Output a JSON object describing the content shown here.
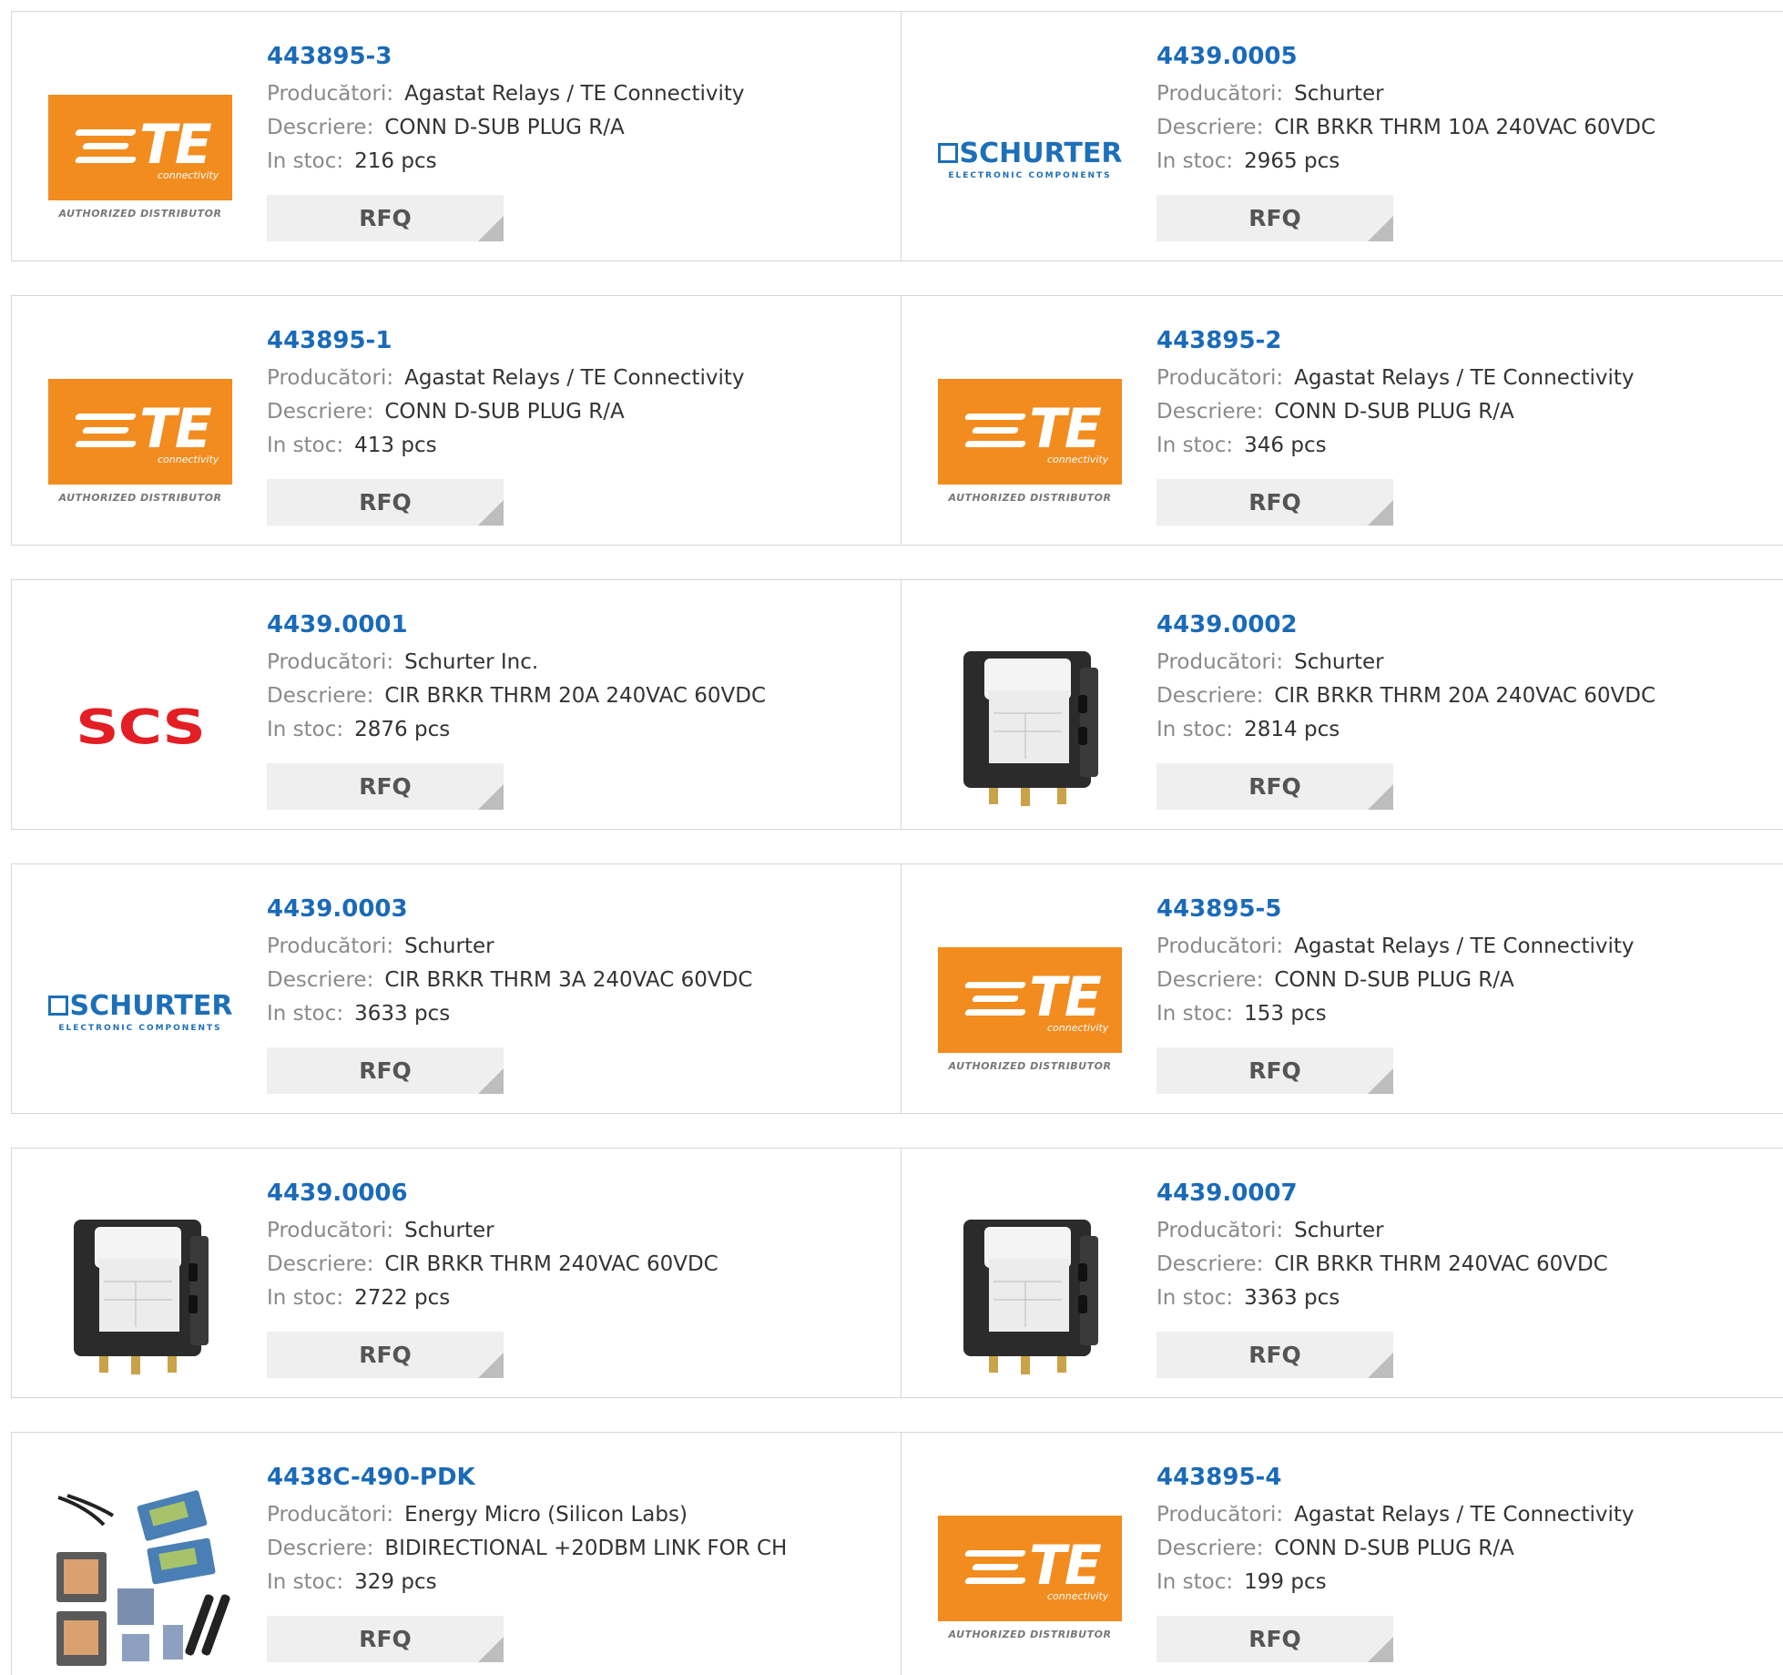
{
  "labels": {
    "manufacturer": "Producători:",
    "description": "Descriere:",
    "stock": "In stoc:",
    "rfq": "RFQ"
  },
  "logo_text": {
    "te": "TE",
    "te_sub": "connectivity",
    "te_authorized": "AUTHORIZED DISTRIBUTOR",
    "schurter": "SCHURTER",
    "schurter_sub": "ELECTRONIC COMPONENTS",
    "scs": "SCS"
  },
  "products": [
    {
      "part": "443895-3",
      "manufacturer": "Agastat Relays / TE Connectivity",
      "description": "CONN D-SUB PLUG R/A",
      "stock": "216 pcs",
      "image": "te-logo"
    },
    {
      "part": "4439.0005",
      "manufacturer": "Schurter",
      "description": "CIR BRKR THRM 10A 240VAC 60VDC",
      "stock": "2965 pcs",
      "image": "schurter-logo"
    },
    {
      "part": "443895-1",
      "manufacturer": "Agastat Relays / TE Connectivity",
      "description": "CONN D-SUB PLUG R/A",
      "stock": "413 pcs",
      "image": "te-logo"
    },
    {
      "part": "443895-2",
      "manufacturer": "Agastat Relays / TE Connectivity",
      "description": "CONN D-SUB PLUG R/A",
      "stock": "346 pcs",
      "image": "te-logo"
    },
    {
      "part": "4439.0001",
      "manufacturer": "Schurter Inc.",
      "description": "CIR BRKR THRM 20A 240VAC 60VDC",
      "stock": "2876 pcs",
      "image": "scs-logo"
    },
    {
      "part": "4439.0002",
      "manufacturer": "Schurter",
      "description": "CIR BRKR THRM 20A 240VAC 60VDC",
      "stock": "2814 pcs",
      "image": "breaker-photo"
    },
    {
      "part": "4439.0003",
      "manufacturer": "Schurter",
      "description": "CIR BRKR THRM 3A 240VAC 60VDC",
      "stock": "3633 pcs",
      "image": "schurter-logo"
    },
    {
      "part": "443895-5",
      "manufacturer": "Agastat Relays / TE Connectivity",
      "description": "CONN D-SUB PLUG R/A",
      "stock": "153 pcs",
      "image": "te-logo"
    },
    {
      "part": "4439.0006",
      "manufacturer": "Schurter",
      "description": "CIR BRKR THRM 240VAC 60VDC",
      "stock": "2722 pcs",
      "image": "breaker-photo"
    },
    {
      "part": "4439.0007",
      "manufacturer": "Schurter",
      "description": "CIR BRKR THRM 240VAC 60VDC",
      "stock": "3363 pcs",
      "image": "breaker-photo"
    },
    {
      "part": "4438C-490-PDK",
      "manufacturer": "Energy Micro (Silicon Labs)",
      "description": "BIDIRECTIONAL +20DBM LINK FOR CH",
      "stock": "329 pcs",
      "image": "devkit-photo"
    },
    {
      "part": "443895-4",
      "manufacturer": "Agastat Relays / TE Connectivity",
      "description": "CONN D-SUB PLUG R/A",
      "stock": "199 pcs",
      "image": "te-logo"
    }
  ]
}
